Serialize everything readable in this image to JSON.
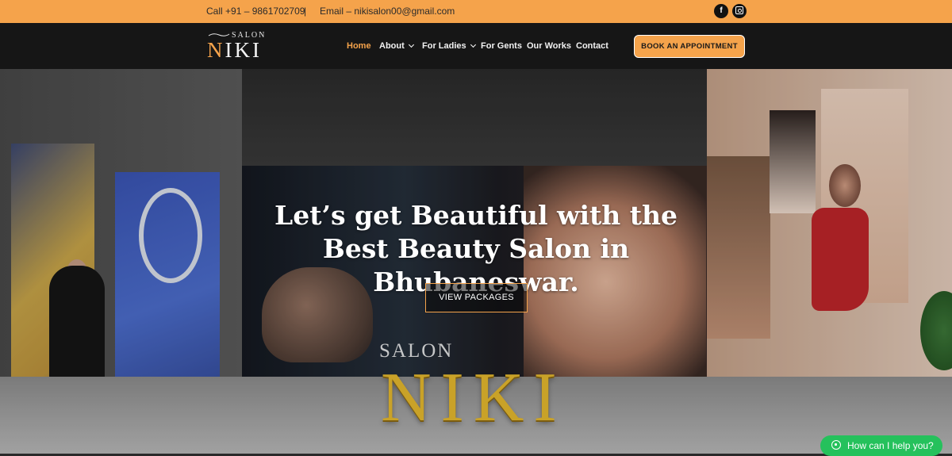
{
  "topbar": {
    "phone": "Call +91 – 9861702709",
    "separator": "|",
    "email": "Email – nikisalon00@gmail.com",
    "social": [
      {
        "icon": "facebook-icon",
        "glyph": "f"
      },
      {
        "icon": "instagram-icon",
        "glyph": ""
      }
    ],
    "bg_color": "#f5a34b"
  },
  "navbar": {
    "logo_small": "SALON",
    "logo_first": "N",
    "logo_rest": "IKI",
    "items": [
      {
        "label": "Home",
        "active": true
      },
      {
        "label": "About",
        "dropdown": true
      },
      {
        "label": "For Ladies",
        "dropdown": true
      },
      {
        "label": "For Gents"
      },
      {
        "label": "Our Works"
      },
      {
        "label": "Contact"
      }
    ],
    "cta": "BOOK AN APPOINTMENT",
    "accent": "#f5a34b"
  },
  "hero": {
    "headline": "Let’s get Beautiful with the Best Beauty Salon in Bhubaneswar.",
    "button": "VIEW PACKAGES",
    "wall_small": "SALON",
    "wall_big": "NIKI"
  },
  "chat": {
    "label": "How can I help you?",
    "icon": "whatsapp-icon",
    "color": "#25c15c"
  }
}
